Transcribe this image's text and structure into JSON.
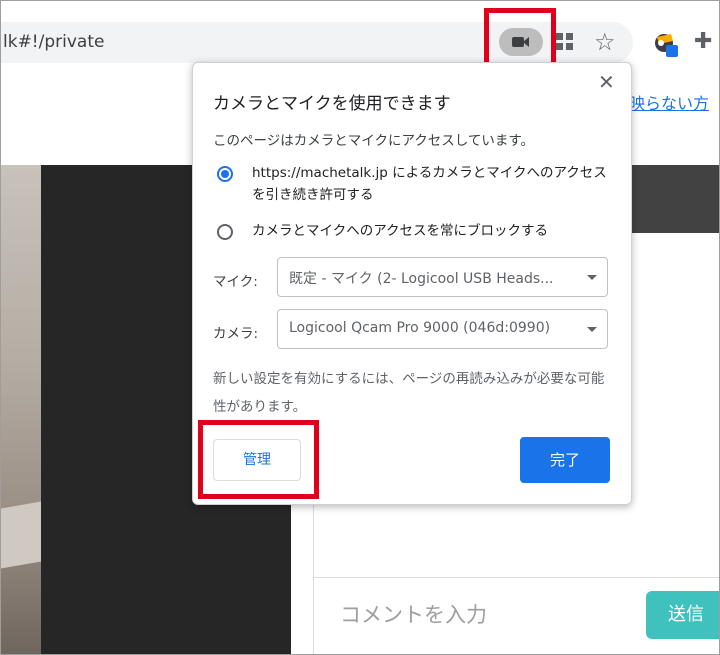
{
  "browser": {
    "url": "lk#!/private",
    "icons": [
      "camera-icon",
      "qr-grid-icon",
      "star-icon",
      "extension-avatar-icon",
      "puzzle-icon"
    ]
  },
  "page": {
    "link_text": "映らない方",
    "comment_placeholder": "コメントを入力",
    "send_label": "送信"
  },
  "permission_bubble": {
    "title": "カメラとマイクを使用できます",
    "description": "このページはカメラとマイクにアクセスしています。",
    "options": [
      {
        "line1": "https://machetalk.jp によるカメラとマイクへのアクセス",
        "line2": "を引き続き許可する",
        "selected": true
      },
      {
        "line1": "カメラとマイクへのアクセスを常にブロックする",
        "selected": false
      }
    ],
    "mic_label": "マイク:",
    "mic_value": "既定 - マイク (2- Logicool USB Heads...",
    "camera_label": "カメラ:",
    "camera_value": "Logicool Qcam Pro 9000 (046d:0990)",
    "note": "新しい設定を有効にするには、ページの再読み込みが必要な可能性があります。",
    "manage_label": "管理",
    "done_label": "完了"
  },
  "colors": {
    "accent": "#1a73e8",
    "highlight": "#e0001b",
    "send": "#3fc1be"
  }
}
